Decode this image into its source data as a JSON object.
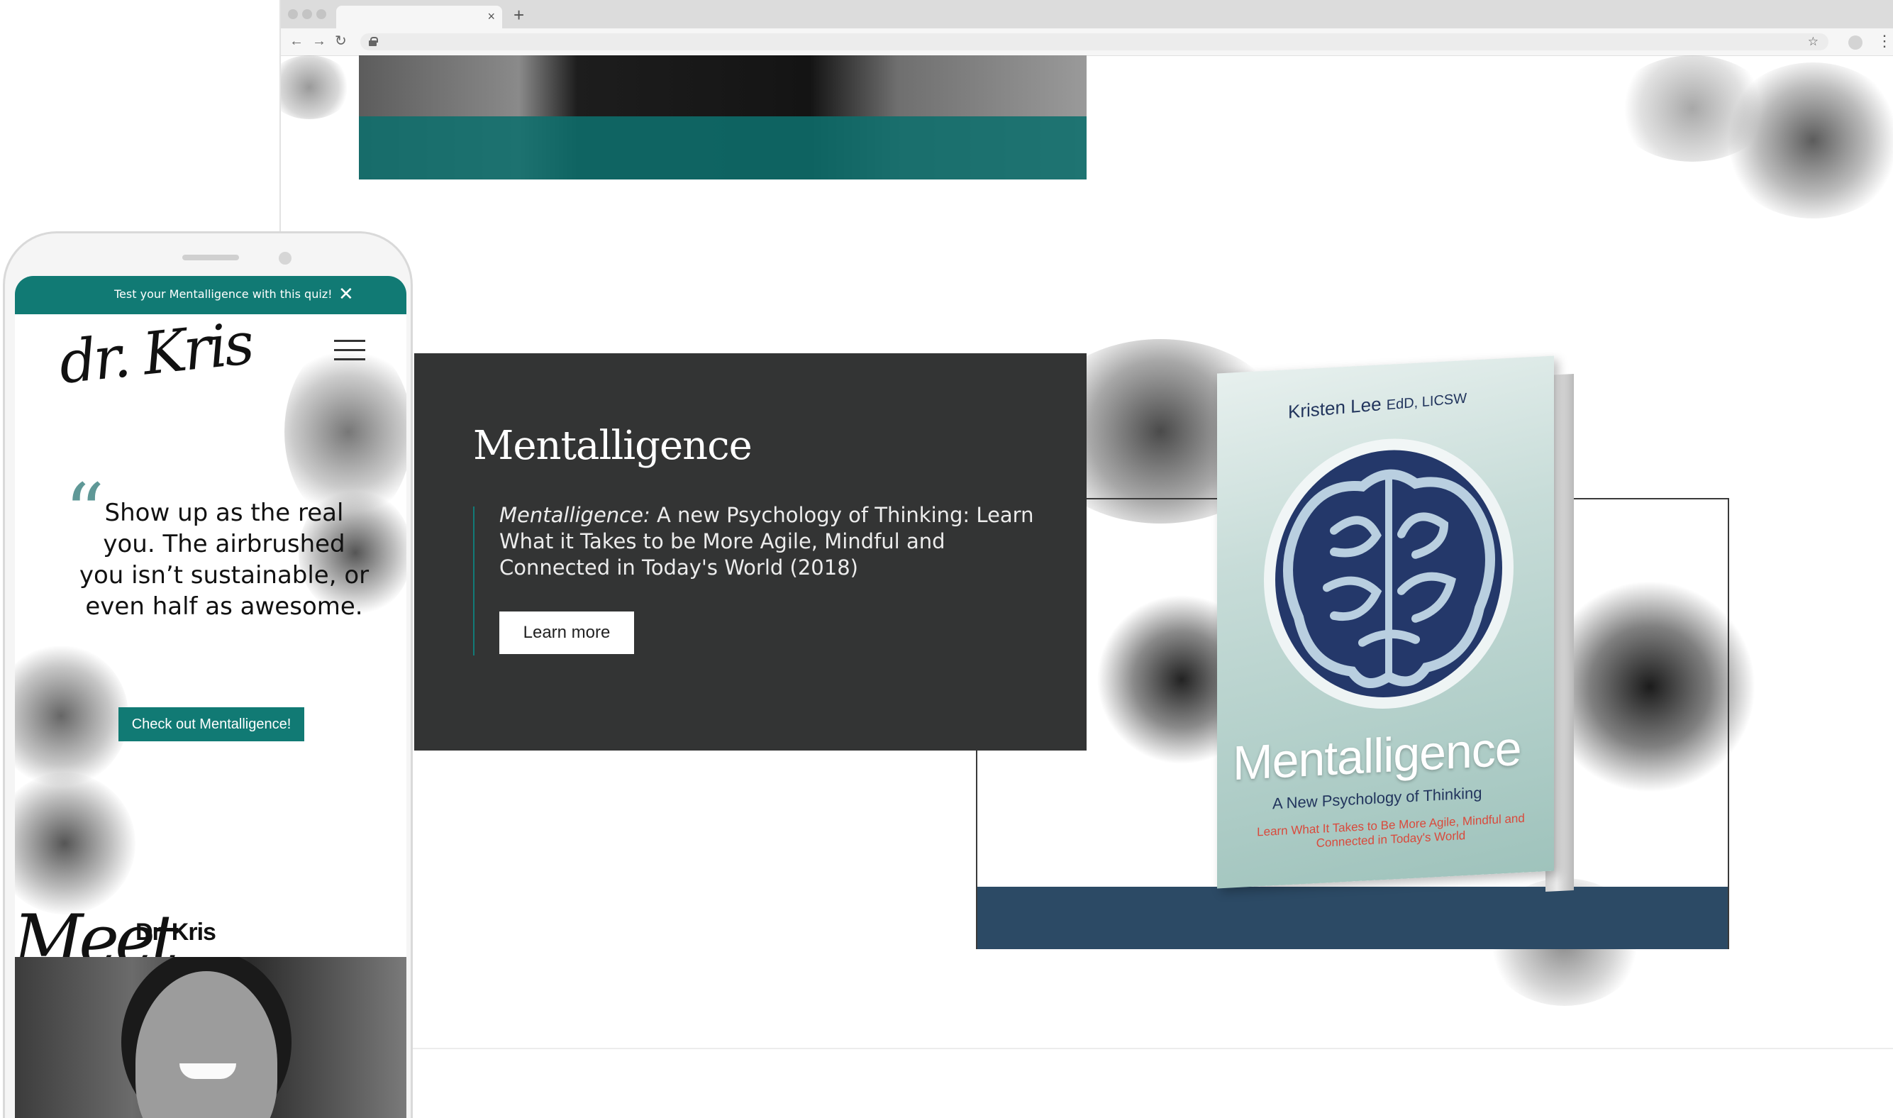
{
  "browser": {
    "tab_close": "×",
    "new_tab": "+",
    "back": "←",
    "forward": "→",
    "reload": "↻",
    "bookmark": "☆",
    "menu": "⋮",
    "icons": [
      "lock-icon",
      "star-icon",
      "back-arrow-icon",
      "forward-arrow-icon",
      "reload-icon",
      "menu-dots-icon"
    ]
  },
  "book_section": {
    "title": "Mentalligence",
    "desc_em": "Mentalligence:",
    "desc_rest": " A new Psychology of Thinking: Learn What it Takes to be More Agile, Mindful and Connected in Today's World (2018)",
    "button_label": "Learn more",
    "accent_color": "#127b77",
    "panel_color": "#333434",
    "band_color": "#2c4a65"
  },
  "book_cover": {
    "author": "Kristen Lee",
    "author_credentials": "EdD, LICSW",
    "title": "Mentalligence",
    "subtitle": "A New Psychology of Thinking",
    "tagline": "Learn What It Takes to Be More Agile, Mindful and Connected in Today's World"
  },
  "mobile": {
    "announcement": "Test your Mentalligence with this quiz!",
    "announcement_close": "✕",
    "logo": "dr. Kris",
    "quote_mark": "“",
    "quote": "Show up as the real you. The airbrushed you isn’t sustainable, or even half as awesome.",
    "cta_label": "Check out Mentalligence!",
    "meet_word": "Meet",
    "meet_name": "Dr. Kris",
    "brand_color": "#117a74"
  }
}
